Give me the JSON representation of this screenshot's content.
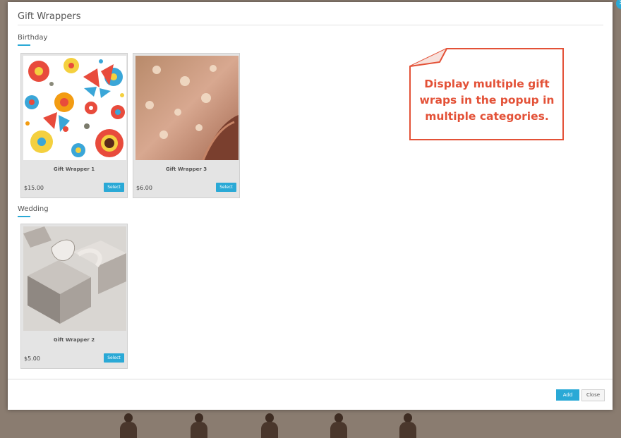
{
  "modal": {
    "title": "Gift Wrappers",
    "close_corner_icon": "x-icon"
  },
  "categories": [
    {
      "name": "Birthday",
      "items": [
        {
          "name": "Gift Wrapper 1",
          "price": "$15.00",
          "select_label": "Select",
          "image": "floral-butterfly-pattern"
        },
        {
          "name": "Gift Wrapper 3",
          "price": "$6.00",
          "select_label": "Select",
          "image": "pink-metallic-flower-paper"
        }
      ]
    },
    {
      "name": "Wedding",
      "items": [
        {
          "name": "Gift Wrapper 2",
          "price": "$5.00",
          "select_label": "Select",
          "image": "silver-wrapped-gift-boxes"
        }
      ]
    }
  ],
  "callout": {
    "lines": [
      "Display multiple gift",
      "wraps in the popup in",
      "multiple categories."
    ],
    "color": "#e35137"
  },
  "footer": {
    "add_label": "Add",
    "close_label": "Close"
  },
  "colors": {
    "accent": "#2aa9d6",
    "backdrop": "#8a7c70"
  }
}
